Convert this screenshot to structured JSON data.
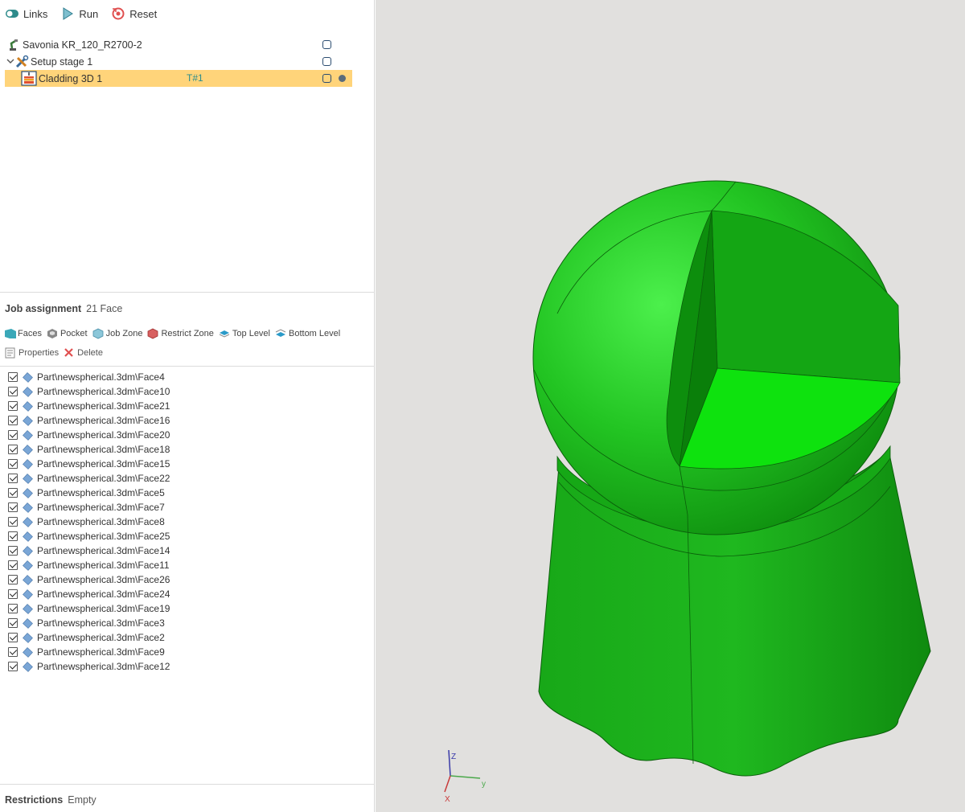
{
  "toolbar": {
    "links_label": "Links",
    "run_label": "Run",
    "reset_label": "Reset"
  },
  "tree": {
    "robot_label": "Savonia KR_120_R2700-2",
    "setup_label": "Setup stage 1",
    "job_label": "Cladding 3D 1",
    "job_tool": "T#1"
  },
  "job_assignment": {
    "title": "Job assignment",
    "count": "21 Face",
    "tools": {
      "faces": "Faces",
      "pocket": "Pocket",
      "job_zone": "Job Zone",
      "restrict_zone": "Restrict Zone",
      "top_level": "Top Level",
      "bottom_level": "Bottom Level",
      "properties": "Properties",
      "delete": "Delete"
    },
    "faces": [
      "Part\\newspherical.3dm\\Face4",
      "Part\\newspherical.3dm\\Face10",
      "Part\\newspherical.3dm\\Face21",
      "Part\\newspherical.3dm\\Face16",
      "Part\\newspherical.3dm\\Face20",
      "Part\\newspherical.3dm\\Face18",
      "Part\\newspherical.3dm\\Face15",
      "Part\\newspherical.3dm\\Face22",
      "Part\\newspherical.3dm\\Face5",
      "Part\\newspherical.3dm\\Face7",
      "Part\\newspherical.3dm\\Face8",
      "Part\\newspherical.3dm\\Face25",
      "Part\\newspherical.3dm\\Face14",
      "Part\\newspherical.3dm\\Face11",
      "Part\\newspherical.3dm\\Face26",
      "Part\\newspherical.3dm\\Face24",
      "Part\\newspherical.3dm\\Face19",
      "Part\\newspherical.3dm\\Face3",
      "Part\\newspherical.3dm\\Face2",
      "Part\\newspherical.3dm\\Face9",
      "Part\\newspherical.3dm\\Face12"
    ]
  },
  "restrictions": {
    "label": "Restrictions",
    "value": "Empty"
  },
  "axes": {
    "z": "Z",
    "y": "y",
    "x": "X"
  },
  "colors": {
    "selection": "#ffd47a",
    "model_green": "#1fbf1f",
    "viewport_bg": "#e1e0de"
  }
}
